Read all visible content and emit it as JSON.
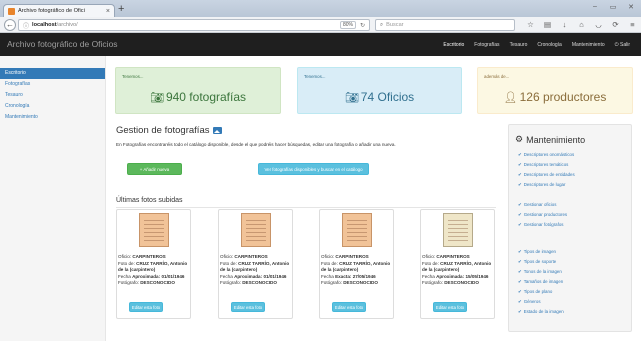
{
  "browser": {
    "tab_title": "Archivo fotográfico de Ofici",
    "tab_close": "×",
    "new_tab": "+",
    "url_host": "localhost",
    "url_path": "/archivo/",
    "zoom": "80%",
    "search_placeholder": "Buscar"
  },
  "app": {
    "brand": "Archivo fotográfico de Oficios",
    "nav": [
      "Escritorio",
      "Fotografías",
      "Tesauro",
      "Cronología",
      "Mantenimiento",
      "Salir"
    ]
  },
  "sidebar": {
    "items": [
      "Escritorio",
      "Fotografías",
      "Tesauro",
      "Cronología",
      "Mantenimiento"
    ]
  },
  "stats": [
    {
      "hint": "Tenemos...",
      "value": "940 fotografías",
      "icon": "camera-icon"
    },
    {
      "hint": "Tenemos...",
      "value": "74 Oficios",
      "icon": "camera-icon"
    },
    {
      "hint": "además de...",
      "value": "126 productores",
      "icon": "user-icon"
    }
  ],
  "gestion": {
    "title": "Gestion de fotografías",
    "description": "En Fotografías encontraréis todo el catálogo disponible, desde el que podréis hacer búsquedas, editar una fotografía o añadir una nueva.",
    "add_button": "+ Añadir nueva",
    "view_button": "Ver fotografías disponibles y buscar en el catálogo"
  },
  "ultimas": {
    "title": "Últimas fotos subidas",
    "cards": [
      {
        "oficio_label": "Oficio:",
        "oficio": "CARPINTEROS",
        "foto_label": "Foto de:",
        "foto": "CRUZ TARRÍO, Antonio",
        "foto2": "de la (carpintero)",
        "fecha_label": "Fecha",
        "fecha_type": "Aproximada:",
        "fecha": "01/01/1946",
        "fotografo_label": "Fotógrafo:",
        "fotografo": "DESCONOCIDO",
        "edit": "Editar esta foto"
      },
      {
        "oficio_label": "Oficio:",
        "oficio": "CARPINTEROS",
        "foto_label": "Foto de:",
        "foto": "CRUZ TARRÍO, Antonio",
        "foto2": "de la (carpintero)",
        "fecha_label": "Fecha",
        "fecha_type": "Aproximada:",
        "fecha": "01/01/1946",
        "fotografo_label": "Fotógrafo:",
        "fotografo": "DESCONOCIDO",
        "edit": "Editar esta foto"
      },
      {
        "oficio_label": "Oficio:",
        "oficio": "CARPINTEROS",
        "foto_label": "Foto de:",
        "foto": "CRUZ TARRÍO, Antonio",
        "foto2": "de la (carpintero)",
        "fecha_label": "Fecha",
        "fecha_type": "Exacta:",
        "fecha": "27/05/1946",
        "fotografo_label": "Fotógrafo:",
        "fotografo": "DESCONOCIDO",
        "edit": "Editar esta foto"
      },
      {
        "oficio_label": "Oficio:",
        "oficio": "CARPINTEROS",
        "foto_label": "Foto de:",
        "foto": "CRUZ TARRÍO, Antonio",
        "foto2": "de la (carpintero)",
        "fecha_label": "Fecha",
        "fecha_type": "Aproximada:",
        "fecha": "15/05/1946",
        "fotografo_label": "Fotógrafo:",
        "fotografo": "DESCONOCIDO",
        "edit": "Editar esta foto"
      }
    ]
  },
  "mantenimiento": {
    "title": "Mantenimiento",
    "items": [
      "Descriptores onomásticos",
      "Descriptores temáticos",
      "Descriptores de entidades",
      "Descriptores de lugar",
      "Gestionar oficios",
      "Gestionar productores",
      "Gestionar fotógrafos",
      "Tipos de imagen",
      "Tipos de soporte",
      "Tonos de la imagen",
      "Tamaños de imagen",
      "Tipos de plano",
      "Géneros",
      "Estado de la imagen"
    ]
  },
  "colors": {
    "primary": "#337ab7",
    "success_bg": "#dff0d8",
    "info_bg": "#d9edf7",
    "warning_bg": "#fcf8e3",
    "navbar": "#1f1f1f"
  }
}
